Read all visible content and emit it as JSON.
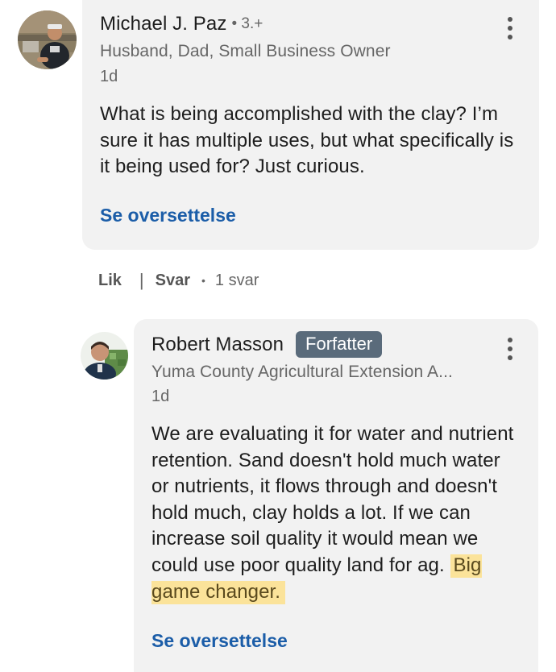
{
  "comment": {
    "author": {
      "name": "Michael J. Paz",
      "degree": "• 3.+",
      "headline": "Husband, Dad, Small Business Owner",
      "avatar_icon": "profile-photo"
    },
    "time": "1d",
    "body": "What is being accomplished with the clay? I’m sure it has multiple uses, but what specifically is it being used for? Just curious.",
    "translate_label": "Se oversettelse",
    "more_icon": "more-vertical-icon"
  },
  "actions": {
    "like_label": "Lik",
    "separator": "|",
    "reply_label": "Svar",
    "dot": "•",
    "reply_count": "1 svar"
  },
  "reply": {
    "author": {
      "name": "Robert Masson",
      "badge": "Forfatter",
      "headline": "Yuma County Agricultural Extension A...",
      "avatar_icon": "profile-photo"
    },
    "time": "1d",
    "body_main": "We are evaluating it for water and nutrient retention. Sand doesn't hold much water or nutrients, it flows through and doesn't hold much, clay holds a lot. If we can increase soil quality it would mean we could use poor quality land for ag.",
    "body_highlight": "Big game changer.",
    "highlight_color": "#fbe39a",
    "translate_label": "Se oversettelse",
    "more_icon": "more-vertical-icon"
  },
  "colors": {
    "bubble": "#f2f2f2",
    "link": "#1b5da8",
    "badge": "#5a6b7b"
  }
}
